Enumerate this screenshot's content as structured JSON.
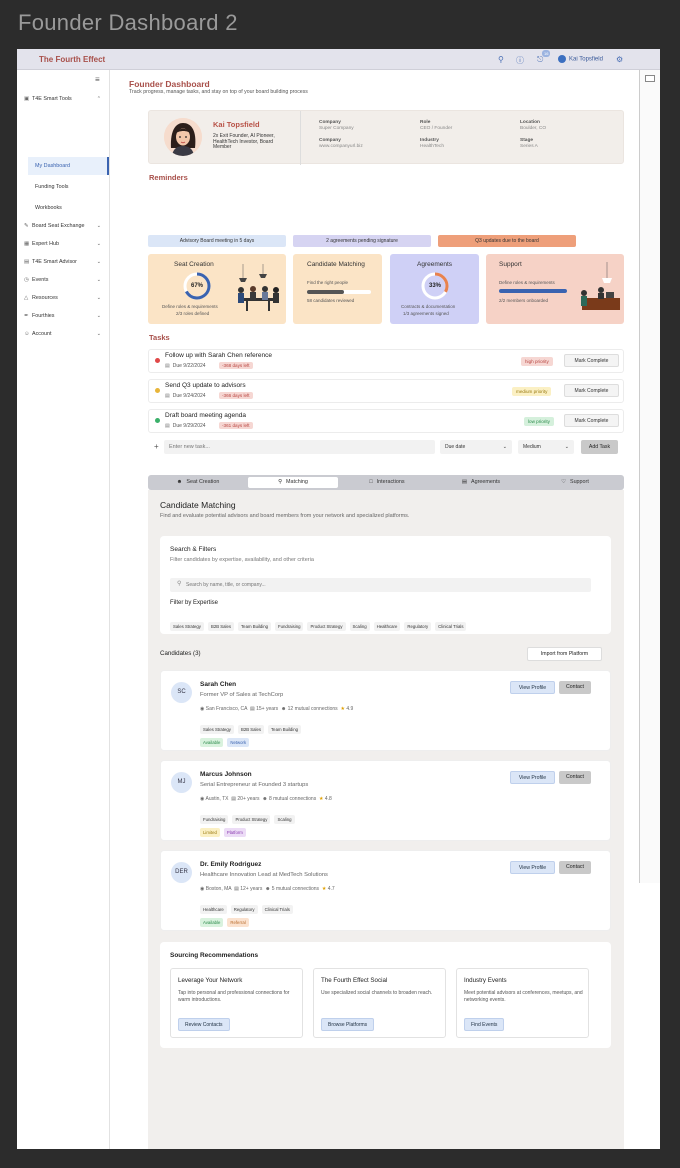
{
  "frame_title": "Founder Dashboard 2",
  "brand": "The Fourth Effect",
  "header": {
    "notif_count": "16",
    "user_name": "Kai Topsfield"
  },
  "sidebar": {
    "items": [
      {
        "label": "T4E Smart Tools",
        "icon": "grid-icon",
        "caret": "^"
      },
      {
        "label": "My Dashboard"
      },
      {
        "label": "Funding Tools"
      },
      {
        "label": "Workbooks"
      },
      {
        "label": "Board Seat Exchange",
        "icon": "edit-icon",
        "caret": "v"
      },
      {
        "label": "Expert Hub",
        "icon": "table-icon",
        "caret": "v"
      },
      {
        "label": "T4E Smart Advisor",
        "icon": "list-icon",
        "caret": "v"
      },
      {
        "label": "Events",
        "icon": "clock-icon",
        "caret": "v"
      },
      {
        "label": "Resources",
        "icon": "warning-icon",
        "caret": "v"
      },
      {
        "label": "Fourthies",
        "icon": "pen-icon",
        "caret": "v"
      },
      {
        "label": "Account",
        "icon": "user-icon",
        "caret": "v"
      }
    ]
  },
  "page": {
    "title": "Founder Dashboard",
    "subtitle": "Track progress, manage tasks, and stay on top of your board building process"
  },
  "profile": {
    "name": "Kai Topsfield",
    "desc": "2x Exit Founder, AI Pioneer, HealthTech Investor, Board Member",
    "fields": [
      {
        "k": "Company",
        "v": "Super Company"
      },
      {
        "k": "Role",
        "v": "CEO / Founder"
      },
      {
        "k": "Location",
        "v": "Boulder, CO"
      },
      {
        "k": "Company",
        "v": "www.companyurl.biz"
      },
      {
        "k": "Industry",
        "v": "HealthTech"
      },
      {
        "k": "Stage",
        "v": "Series A"
      }
    ]
  },
  "reminders": {
    "title": "Reminders",
    "items": [
      "Advisory Board meeting in 5 days",
      "2 agreements pending signature",
      "Q3 updates due to the board"
    ]
  },
  "cards": [
    {
      "title": "Seat Creation",
      "pct": "67%",
      "pct_value": 0.67,
      "s1": "Define roles & requirements",
      "s2": "2/3 roles defined"
    },
    {
      "title": "Candidate Matching",
      "s1": "Find the right people",
      "progress": 0.58,
      "s2": "58 candidates reviewed"
    },
    {
      "title": "Agreements",
      "pct": "33%",
      "pct_value": 0.33,
      "s1": "Contracts & documentation",
      "s2": "1/3 agreements signed"
    },
    {
      "title": "Support",
      "s1": "Define roles & requirements",
      "progress": 1.0,
      "s2": "2/2 members onboarded"
    }
  ],
  "tasks": {
    "title": "Tasks",
    "mark_label": "Mark Complete",
    "items": [
      {
        "title": "Follow up with Sarah Chen reference",
        "due": "Due 9/22/2024",
        "left": "-368 days left",
        "priority": "high priority"
      },
      {
        "title": "Send Q3 update to advisors",
        "due": "Due 9/24/2024",
        "left": "-366 days left",
        "priority": "medium priority"
      },
      {
        "title": "Draft board meeting agenda",
        "due": "Due 9/29/2024",
        "left": "-361 days left",
        "priority": "low priority"
      }
    ],
    "new_placeholder": "Enter new task...",
    "due_label": "Due date",
    "priority_value": "Medium",
    "add_label": "Add Task"
  },
  "tabs": [
    "Seat Creation",
    "Matching",
    "Interactions",
    "Agreements",
    "Support"
  ],
  "matching": {
    "title": "Candidate Matching",
    "subtitle": "Find and evaluate potential advisors and board members from your network and specialized platforms.",
    "search": {
      "title": "Search & Filters",
      "subtitle": "Filter candidates by expertise, availability, and other criteria",
      "placeholder": "Search by name, title, or company...",
      "filter_label": "Filter by Expertise",
      "chips": [
        "Sales Strategy",
        "B2B Sales",
        "Team Building",
        "Fundraising",
        "Product Strategy",
        "Scaling",
        "Healthcare",
        "Regulatory",
        "Clinical Trials"
      ]
    },
    "candidates_label": "Candidates (3)",
    "import_label": "Import from Platform",
    "view_label": "View Profile",
    "contact_label": "Contact",
    "candidates": [
      {
        "initials": "SC",
        "name": "Sarah Chen",
        "role": "Former VP of Sales at TechCorp",
        "location": "San Francisco, CA",
        "years": "15+ years",
        "connections": "12 mutual connections",
        "rating": "4.9",
        "tags": [
          "Sales Strategy",
          "B2B Sales",
          "Team Building"
        ],
        "status": "Available",
        "source": "Network"
      },
      {
        "initials": "MJ",
        "name": "Marcus Johnson",
        "role": "Serial Entrepreneur at Founded 3 startups",
        "location": "Austin, TX",
        "years": "20+ years",
        "connections": "8 mutual connections",
        "rating": "4.8",
        "tags": [
          "Fundraising",
          "Product Strategy",
          "Scaling"
        ],
        "status": "Limited",
        "source": "Platform"
      },
      {
        "initials": "DER",
        "name": "Dr. Emily Rodriguez",
        "role": "Healthcare Innovation Lead at MedTech Solutions",
        "location": "Boston, MA",
        "years": "12+ years",
        "connections": "5 mutual connections",
        "rating": "4.7",
        "tags": [
          "Healthcare",
          "Regulatory",
          "Clinical Trials"
        ],
        "status": "Available",
        "source": "Referral"
      }
    ],
    "sourcing": {
      "title": "Sourcing Recommendations",
      "items": [
        {
          "title": "Leverage Your Network",
          "desc": "Tap into personal and professional connections for warm introductions.",
          "btn": "Review Contacts"
        },
        {
          "title": "The Fourth Effect Social",
          "desc": "Use specialized social channels to broaden  reach.",
          "btn": "Browse Platforms"
        },
        {
          "title": "Industry Events",
          "desc": "Meet potential advisors at conferences, meetups, and networking events.",
          "btn": "Find Events"
        }
      ]
    }
  },
  "colors": {
    "brand": "#a8504a",
    "accent": "#3a63b0",
    "reminder1": "#dbe6f7",
    "reminder2": "#d6d4f2",
    "reminder3": "#ee9f7a"
  }
}
